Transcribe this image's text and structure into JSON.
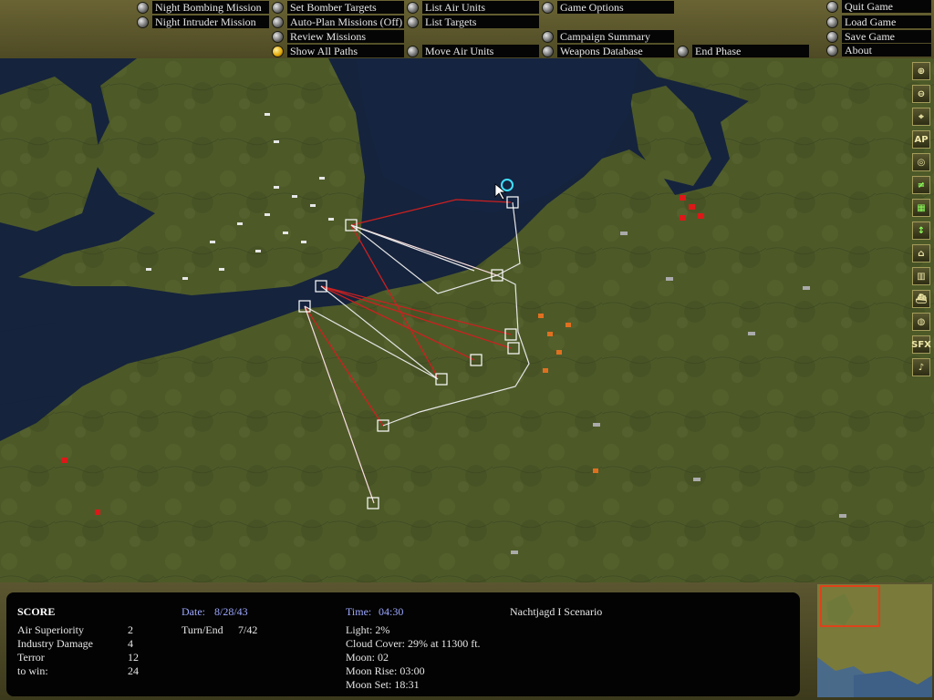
{
  "menu": {
    "col1": [
      "Night Bombing Mission",
      "Night Intruder Mission"
    ],
    "col2": [
      "Set Bomber Targets",
      "Auto-Plan Missions (Off)",
      "Review Missions",
      "Show All Paths"
    ],
    "col3": [
      "List Air Units",
      "List Targets",
      "Move Air Units"
    ],
    "col4": [
      "Game Options",
      "Campaign Summary",
      "Weapons Database"
    ],
    "end_phase": "End Phase",
    "col5": [
      "Quit Game",
      "Load Game",
      "Save Game",
      "About"
    ]
  },
  "toolbar": [
    "zoom-in",
    "zoom-out",
    "center",
    "AP",
    "target",
    "weather",
    "airfield",
    "flak",
    "factory",
    "city",
    "ship",
    "radar",
    "SFX",
    "music"
  ],
  "toolbar_labels": {
    "ap": "AP",
    "sfx": "SFX",
    "music": "♪"
  },
  "score": {
    "title": "SCORE",
    "rows": [
      {
        "label": "Air Superiority",
        "value": "2"
      },
      {
        "label": "Industry Damage",
        "value": "4"
      },
      {
        "label": "Terror",
        "value": "12"
      },
      {
        "label": "to win:",
        "value": "24"
      }
    ]
  },
  "date": {
    "label": "Date:",
    "value": "8/28/43"
  },
  "turn": {
    "label": "Turn/End",
    "value": "7/42"
  },
  "time": {
    "label": "Time:",
    "value": "04:30"
  },
  "conditions": [
    "Light: 2%",
    "Cloud Cover: 29% at 11300 ft.",
    "Moon: 02",
    "Moon Rise: 03:00",
    "Moon Set: 18:31"
  ],
  "scenario": "Nachtjagd I Scenario",
  "colors": {
    "land": "#4d5a28",
    "sea": "#15233d",
    "route_red": "#cc2020",
    "route_white": "#e6e6e6",
    "menu_panel": "#5c5830"
  }
}
